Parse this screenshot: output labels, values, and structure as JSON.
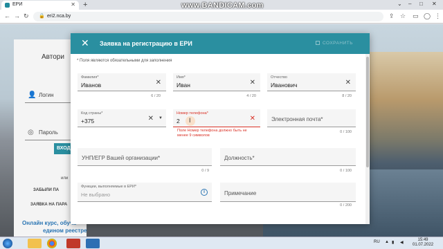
{
  "browser": {
    "tab_title": "ЕРИ",
    "url": "eri2.nca.by",
    "watermark": "www.BANDICAM.com"
  },
  "login": {
    "title": "Автори",
    "login_label": "Логин",
    "password_label": "Пароль",
    "enter_button": "ВХОД",
    "or_text": "или",
    "forgot": "ЗАБЫЛИ ПА",
    "request": "ЗАЯВКА НА ПАРА",
    "course_line1": "Онлайн курс, обуча",
    "course_line2": "едином реестре"
  },
  "modal": {
    "title": "Заявка на регистрацию в ЕРИ",
    "save_label": "СОХРАНИТЬ",
    "required_note": "* Поля являются обязательными для заполнения",
    "surname": {
      "label": "Фамилия*",
      "value": "Иванов",
      "counter": "6 / 20"
    },
    "name": {
      "label": "Имя*",
      "value": "Иван",
      "counter": "4 / 20"
    },
    "patronymic": {
      "label": "Отчество",
      "value": "Иванович",
      "counter": "8 / 20"
    },
    "country_code": {
      "label": "Код страны*",
      "value": "+375"
    },
    "phone": {
      "label": "Номер телефона*",
      "value": "2",
      "error": "Поле Номер телефона должно быть не менее 9 символов"
    },
    "email": {
      "placeholder": "Электронная почта*",
      "counter": "0 / 100"
    },
    "unp": {
      "placeholder": "УНП/ЕГР Вашей организации*",
      "counter": "0 / 9"
    },
    "position": {
      "placeholder": "Должность*",
      "counter": "0 / 100"
    },
    "functions": {
      "label": "Функции, выполняемые в ЕРИ*",
      "value": "Не выбрано"
    },
    "note": {
      "placeholder": "Примечание",
      "counter": "0 / 200"
    }
  },
  "taskbar": {
    "language": "RU",
    "time": "15:49",
    "date": "01.07.2022"
  }
}
